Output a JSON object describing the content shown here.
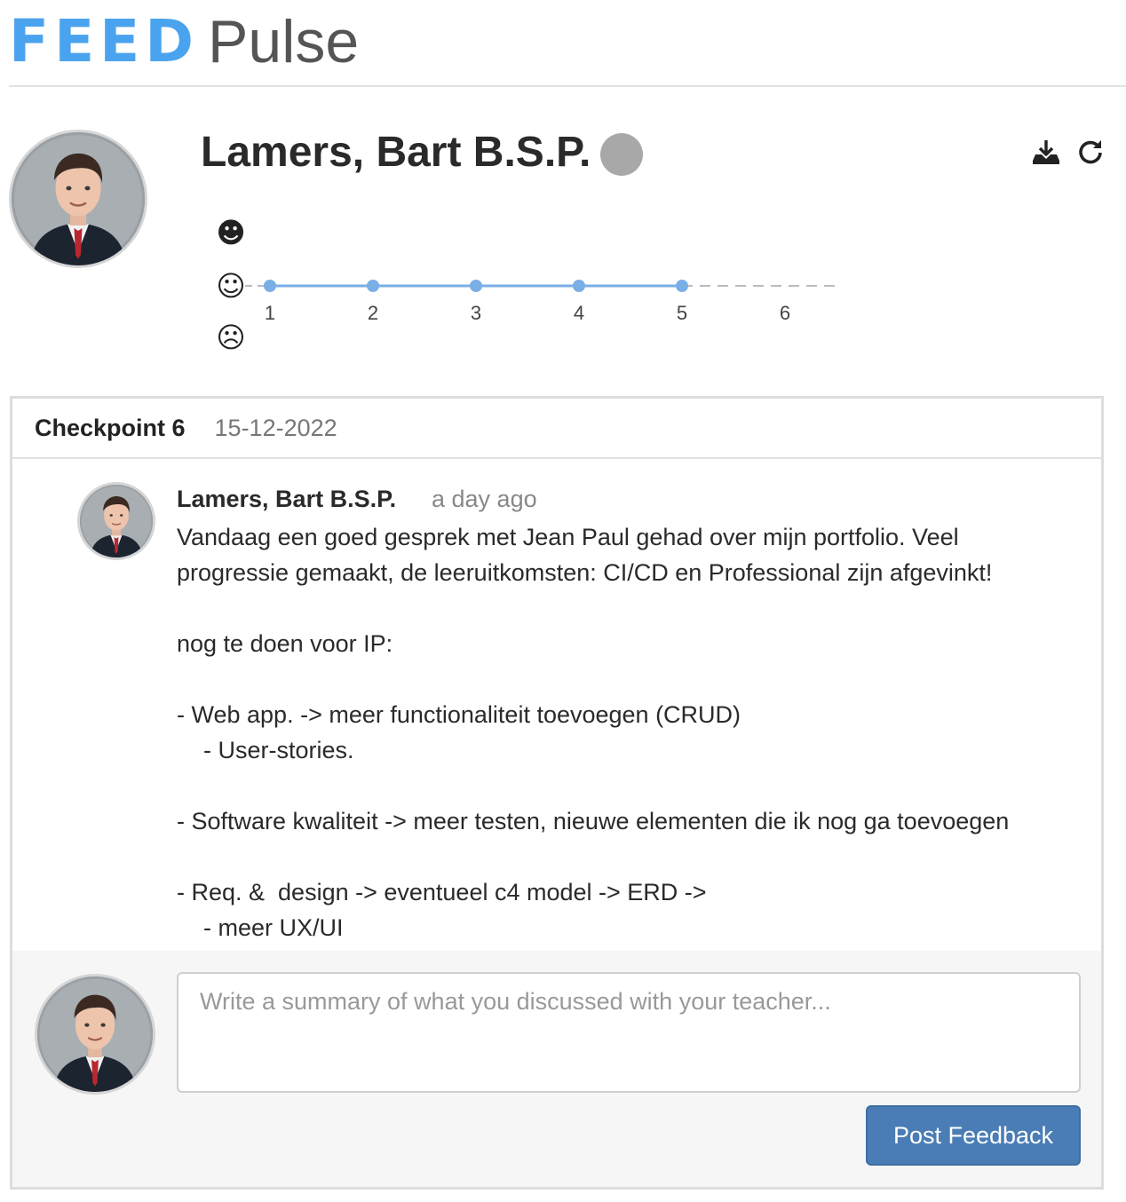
{
  "brand": {
    "logo_feed": "FEED",
    "logo_pulse": "Pulse",
    "accent_color": "#4aa3ee"
  },
  "student": {
    "name": "Lamers, Bart B.S.P.",
    "status_color": "#a8a8a8"
  },
  "toolbar": {
    "download_icon": "download-icon",
    "refresh_icon": "refresh-icon"
  },
  "chart_data": {
    "type": "line",
    "x": [
      1,
      2,
      3,
      4,
      5,
      6
    ],
    "categories": [
      "1",
      "2",
      "3",
      "4",
      "5",
      "6"
    ],
    "y_levels": [
      "sad",
      "neutral",
      "happy"
    ],
    "y_level_glyphs": [
      "☹",
      "☺",
      "☻"
    ],
    "series": [
      {
        "values": [
          "neutral",
          "neutral",
          "neutral",
          "neutral",
          "neutral",
          null
        ]
      }
    ],
    "line_color": "#7aaee6",
    "pending_line_color": "#b8bcc2"
  },
  "checkpoint": {
    "title": "Checkpoint 6",
    "date": "15-12-2022",
    "comment": {
      "author": "Lamers, Bart B.S.P.",
      "time": "a day ago",
      "lines": [
        "Vandaag een goed gesprek met Jean Paul gehad over mijn portfolio. Veel",
        "progressie gemaakt, de leeruitkomsten: CI/CD en Professional zijn afgevinkt!",
        "",
        "nog te doen voor IP:",
        "",
        "- Web app. -> meer functionaliteit toevoegen (CRUD)",
        "    - User-stories.",
        "",
        "- Software kwaliteit -> meer testen, nieuwe elementen die ik nog ga toevoegen",
        "",
        "- Req. &  design -> eventueel c4 model -> ERD ->",
        "    - meer UX/UI"
      ]
    },
    "composer": {
      "placeholder": "Write a summary of what you discussed with your teacher...",
      "value": "",
      "post_label": "Post Feedback",
      "button_color": "#4a7db5"
    }
  }
}
